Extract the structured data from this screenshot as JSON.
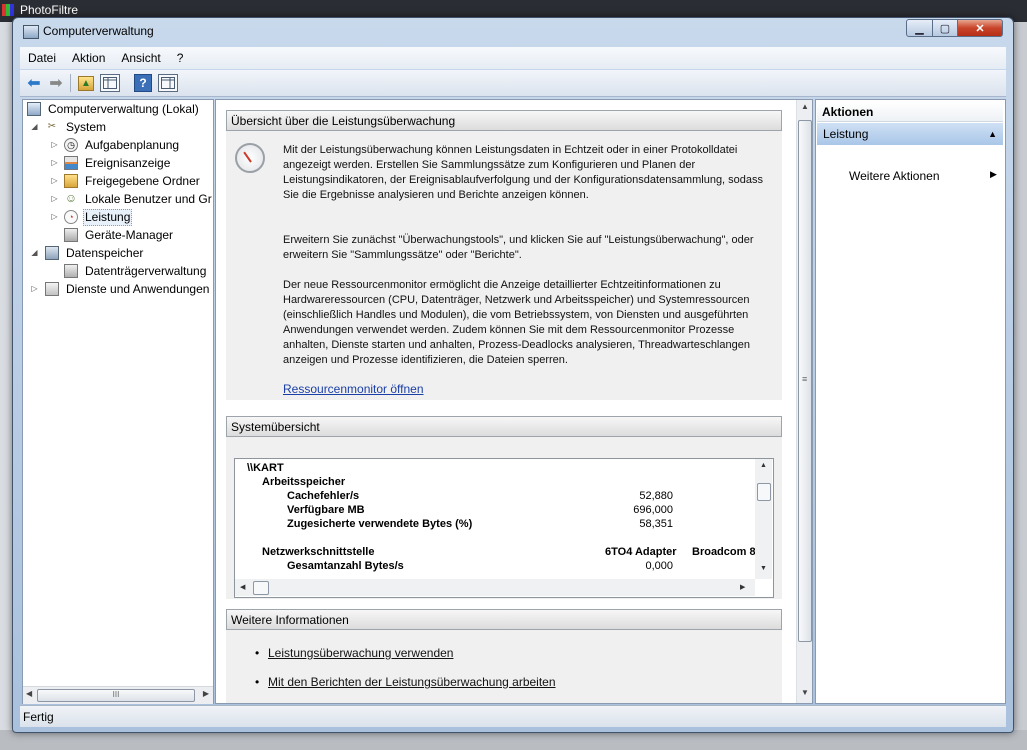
{
  "background": {
    "app_title": "PhotoFiltre"
  },
  "window": {
    "title": "Computerverwaltung",
    "minimize_glyph": "▁",
    "maximize_glyph": "▢",
    "close_glyph": "✕"
  },
  "menu": {
    "items": [
      "Datei",
      "Aktion",
      "Ansicht",
      "?"
    ]
  },
  "toolbar": {
    "back_glyph": "⬅",
    "forward_glyph": "➡",
    "help_glyph": "?"
  },
  "tree": {
    "items": [
      {
        "label": "Computerverwaltung (Lokal)",
        "icon": "computer-icon",
        "expander": ""
      },
      {
        "label": "System",
        "icon": "tools-icon",
        "expander": "◢"
      },
      {
        "label": "Aufgabenplanung",
        "icon": "clock-icon",
        "expander": "▷"
      },
      {
        "label": "Ereignisanzeige",
        "icon": "event-viewer-icon",
        "expander": "▷"
      },
      {
        "label": "Freigegebene Ordner",
        "icon": "shared-folder-icon",
        "expander": "▷"
      },
      {
        "label": "Lokale Benutzer und Gr",
        "icon": "users-icon",
        "expander": "▷"
      },
      {
        "label": "Leistung",
        "icon": "performance-icon",
        "expander": "▷"
      },
      {
        "label": "Geräte-Manager",
        "icon": "device-manager-icon",
        "expander": ""
      },
      {
        "label": "Datenspeicher",
        "icon": "storage-icon",
        "expander": "◢"
      },
      {
        "label": "Datenträgerverwaltung",
        "icon": "disk-icon",
        "expander": ""
      },
      {
        "label": "Dienste und Anwendungen",
        "icon": "services-icon",
        "expander": "▷"
      }
    ],
    "scroll_grip": "III"
  },
  "overview": {
    "heading": "Übersicht über die Leistungsüberwachung",
    "para1": "Mit der Leistungsüberwachung können Leistungsdaten in Echtzeit oder in einer Protokolldatei angezeigt werden. Erstellen Sie Sammlungssätze zum Konfigurieren und Planen der Leistungsindikatoren, der Ereignisablaufverfolgung und der Konfigurationsdatensammlung, sodass Sie die Ergebnisse analysieren und Berichte anzeigen können.",
    "para2": "Erweitern Sie zunächst \"Überwachungstools\", und klicken Sie auf \"Leistungsüberwachung\", oder erweitern Sie \"Sammlungssätze\" oder \"Berichte\".",
    "para3": "Der neue Ressourcenmonitor ermöglicht die Anzeige detaillierter Echtzeitinformationen zu Hardwareressourcen (CPU, Datenträger, Netzwerk und Arbeitsspeicher) und Systemressourcen (einschließlich Handles und Modulen), die vom Betriebssystem, von Diensten und ausgeführten Anwendungen verwendet werden. Zudem können Sie mit dem Ressourcenmonitor Prozesse anhalten, Dienste starten und anhalten, Prozess-Deadlocks analysieren, Threadwarteschlangen anzeigen und Prozesse identifizieren, die Dateien sperren.",
    "link": "Ressourcenmonitor öffnen"
  },
  "system_overview": {
    "heading": "Systemübersicht",
    "machine": "\\\\KART",
    "group1": "Arbeitsspeicher",
    "rows": [
      {
        "label": "Cachefehler/s",
        "value": "52,880"
      },
      {
        "label": "Verfügbare MB",
        "value": "696,000"
      },
      {
        "label": "Zugesicherte verwendete Bytes (%)",
        "value": "58,351"
      }
    ],
    "group2": "Netzwerkschnittstelle",
    "col1": "6TO4 Adapter",
    "col2": "Broadcom 8",
    "row_net": {
      "label": "Gesamtanzahl Bytes/s",
      "value": "0,000"
    }
  },
  "more_info": {
    "heading": "Weitere Informationen",
    "links": [
      "Leistungsüberwachung verwenden",
      "Mit den Berichten der Leistungsüberwachung arbeiten"
    ]
  },
  "actions": {
    "heading": "Aktionen",
    "section": "Leistung",
    "item": "Weitere Aktionen"
  },
  "status": {
    "text": "Fertig"
  },
  "colors": {
    "accent": "#a9c6e8",
    "link": "#1a3fa6",
    "close_button": "#c8442a"
  }
}
